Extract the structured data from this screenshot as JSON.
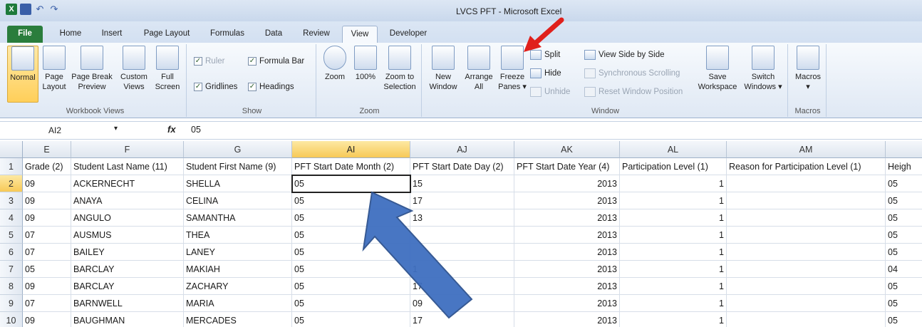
{
  "window": {
    "title": "LVCS PFT - Microsoft Excel"
  },
  "tabs": [
    {
      "label": "File"
    },
    {
      "label": "Home"
    },
    {
      "label": "Insert"
    },
    {
      "label": "Page Layout"
    },
    {
      "label": "Formulas"
    },
    {
      "label": "Data"
    },
    {
      "label": "Review"
    },
    {
      "label": "View"
    },
    {
      "label": "Developer"
    }
  ],
  "ribbon": {
    "workbook_views": {
      "label": "Workbook Views",
      "normal": "Normal",
      "page_layout_1": "Page",
      "page_layout_2": "Layout",
      "page_break_1": "Page Break",
      "page_break_2": "Preview",
      "custom_1": "Custom",
      "custom_2": "Views",
      "full_1": "Full",
      "full_2": "Screen"
    },
    "show": {
      "label": "Show",
      "ruler": "Ruler",
      "formula_bar": "Formula Bar",
      "gridlines": "Gridlines",
      "headings": "Headings"
    },
    "zoom": {
      "label": "Zoom",
      "zoom": "Zoom",
      "hundred": "100%",
      "sel_1": "Zoom to",
      "sel_2": "Selection"
    },
    "window": {
      "label": "Window",
      "new_1": "New",
      "new_2": "Window",
      "arrange_1": "Arrange",
      "arrange_2": "All",
      "freeze_1": "Freeze",
      "freeze_2": "Panes ▾",
      "split": "Split",
      "hide": "Hide",
      "unhide": "Unhide",
      "side_by_side": "View Side by Side",
      "sync": "Synchronous Scrolling",
      "reset": "Reset Window Position",
      "save_1": "Save",
      "save_2": "Workspace",
      "switch_1": "Switch",
      "switch_2": "Windows ▾"
    },
    "macros": {
      "label": "Macros",
      "btn": "Macros",
      "arrow": "▾"
    }
  },
  "formula_bar": {
    "name_box": "AI2",
    "fx": "fx",
    "value": "05"
  },
  "grid": {
    "columns": [
      "E",
      "F",
      "G",
      "AI",
      "AJ",
      "AK",
      "AL",
      "AM",
      ""
    ],
    "rows": [
      "1",
      "2",
      "3",
      "4",
      "5",
      "6",
      "7",
      "8",
      "9",
      "10"
    ],
    "header_row": [
      "Grade (2)",
      "Student Last Name (11)",
      "Student First Name (9)",
      "PFT Start Date Month (2)",
      "PFT Start Date Day (2)",
      "PFT Start Date Year (4)",
      "Participation Level (1)",
      "Reason for Participation Level (1)",
      "Heigh"
    ],
    "data": [
      [
        "09",
        "ACKERNECHT",
        "SHELLA",
        "05",
        "15",
        "2013",
        "1",
        "",
        "05"
      ],
      [
        "09",
        "ANAYA",
        "CELINA",
        "05",
        "17",
        "2013",
        "1",
        "",
        "05"
      ],
      [
        "09",
        "ANGULO",
        "SAMANTHA",
        "05",
        "13",
        "2013",
        "1",
        "",
        "05"
      ],
      [
        "07",
        "AUSMUS",
        "THEA",
        "05",
        "",
        "2013",
        "1",
        "",
        "05"
      ],
      [
        "07",
        "BAILEY",
        "LANEY",
        "05",
        "",
        "2013",
        "1",
        "",
        "05"
      ],
      [
        "05",
        "BARCLAY",
        "MAKIAH",
        "05",
        "1",
        "2013",
        "1",
        "",
        "04"
      ],
      [
        "09",
        "BARCLAY",
        "ZACHARY",
        "05",
        "17",
        "2013",
        "1",
        "",
        "05"
      ],
      [
        "07",
        "BARNWELL",
        "MARIA",
        "05",
        "09",
        "2013",
        "1",
        "",
        "05"
      ],
      [
        "09",
        "BAUGHMAN",
        "MERCADES",
        "05",
        "17",
        "2013",
        "1",
        "",
        "05"
      ]
    ]
  },
  "colors": {
    "annotation_red": "#e0201b",
    "annotation_blue": "#3f6fc0",
    "selected_header": "#f7c957"
  }
}
